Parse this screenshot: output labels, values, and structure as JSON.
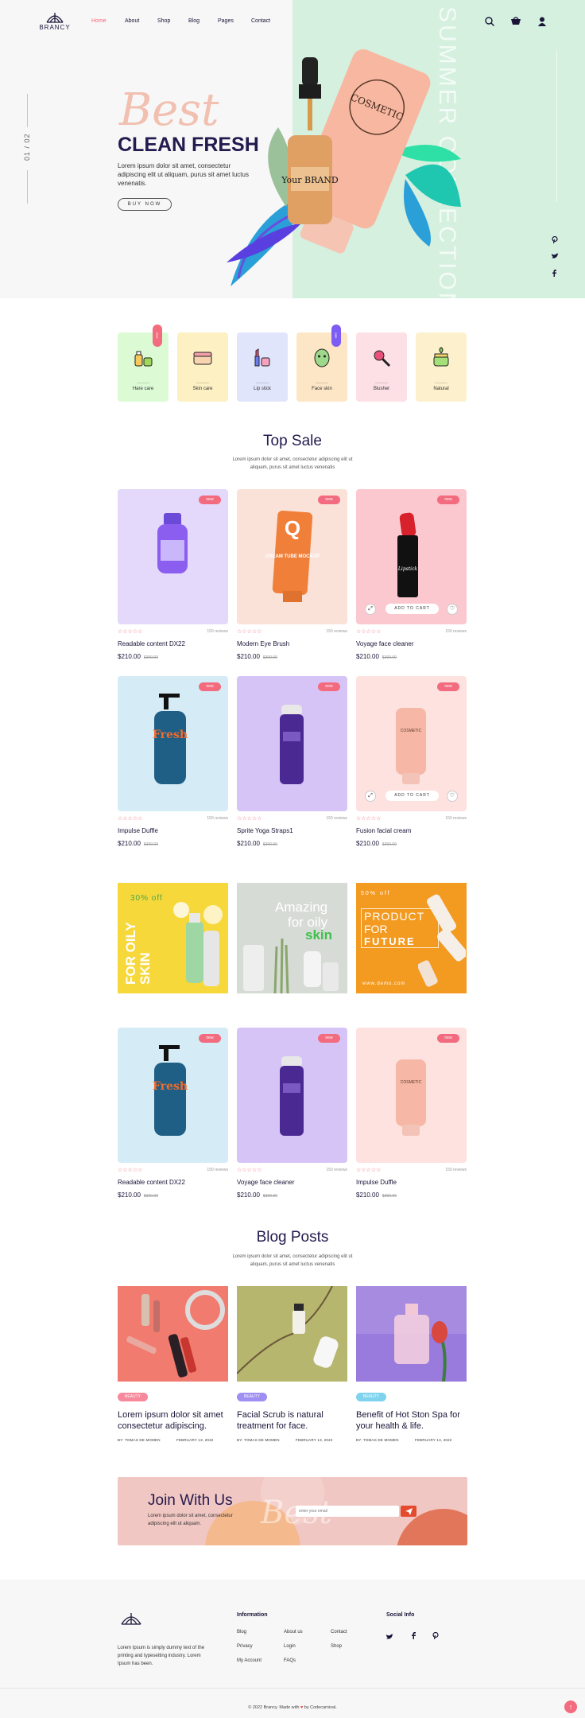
{
  "brand": {
    "name": "BRANCY"
  },
  "nav": {
    "home": "Home",
    "about": "About",
    "shop": "Shop",
    "blog": "Blog",
    "pages": "Pages",
    "contact": "Contact"
  },
  "icons": {
    "search": "search-icon",
    "cart": "cart-icon",
    "user": "user-icon",
    "pinterest": "pinterest-icon",
    "twitter": "twitter-icon",
    "facebook": "facebook-icon"
  },
  "hero": {
    "slide_counter": "01 / 02",
    "script": "Best",
    "title": "CLEAN FRESH",
    "description": "Lorem ipsum dolor sit amet, consectetur adipiscing elit ut aliquam, purus sit amet luctus venenatis.",
    "button": "BUY NOW",
    "side_text": "SUMMER COLLECTION",
    "tube_label": "COSMETIC",
    "bottle_label": "Your BRAND"
  },
  "categories": [
    {
      "label": "Hare care",
      "bg": "#dcfbd5",
      "badge": "new",
      "badge_color": "#f36b7f"
    },
    {
      "label": "Skin care",
      "bg": "#fdf0c3"
    },
    {
      "label": "Lip stick",
      "bg": "#e1e5fb"
    },
    {
      "label": "Face skin",
      "bg": "#fde6c6",
      "badge": "sale",
      "badge_color": "#7c5cf4"
    },
    {
      "label": "Blusher",
      "bg": "#fde0e6"
    },
    {
      "label": "Natural",
      "bg": "#fdf0cd"
    }
  ],
  "top_sale": {
    "title": "Top Sale",
    "description": "Lorem ipsum dolor sit amet, consectetur adipiscing elit ut aliquam, purus sit amet luctus venenatis"
  },
  "product_common": {
    "badge": "new",
    "stars": "☆☆☆☆☆",
    "add_to_cart": "ADD TO CART",
    "expand_icon": "expand-icon",
    "heart_icon": "heart-icon"
  },
  "products": [
    {
      "name": "Readable content DX22",
      "price": "$210.00",
      "old_price": "$300.00",
      "reviews": "150 reviews",
      "bg": "#e4d8fb"
    },
    {
      "name": "Modern Eye Brush",
      "price": "$210.00",
      "old_price": "$300.00",
      "reviews": "150 reviews",
      "bg": "#fbe2d8"
    },
    {
      "name": "Voyage face cleaner",
      "price": "$210.00",
      "old_price": "$300.00",
      "reviews": "150 reviews",
      "bg": "#fbc8cf"
    },
    {
      "name": "Impulse Duffle",
      "price": "$210.00",
      "old_price": "$300.00",
      "reviews": "150 reviews",
      "bg": "#d5ecf7"
    },
    {
      "name": "Sprite Yoga Straps1",
      "price": "$210.00",
      "old_price": "$300.00",
      "reviews": "150 reviews",
      "bg": "#d7c4f6"
    },
    {
      "name": "Fusion facial cream",
      "price": "$210.00",
      "old_price": "$300.00",
      "reviews": "150 reviews",
      "bg": "#fde2df"
    },
    {
      "name": "Readable content DX22",
      "price": "$210.00",
      "old_price": "$300.00",
      "reviews": "150 reviews",
      "bg": "#d5ecf7"
    },
    {
      "name": "Voyage face cleaner",
      "price": "$210.00",
      "old_price": "$300.00",
      "reviews": "150 reviews",
      "bg": "#d7c4f6"
    },
    {
      "name": "Impulse Duffle",
      "price": "$210.00",
      "old_price": "$300.00",
      "reviews": "150 reviews",
      "bg": "#fde2df"
    }
  ],
  "product_art": {
    "cream_tube": "CREAM TUBE MOCKUP",
    "tube_letter": "Q",
    "fresh": "Fresh",
    "cosmetic": "COSMETIC",
    "lipstick": "Lipstick"
  },
  "banners": {
    "b1_discount": "30% off",
    "b1_text": "FOR OILY SKIN",
    "b2_line1": "Amazing",
    "b2_line2": "for oily",
    "b2_line3": "skin",
    "b3_off": "50% off",
    "b3_line1": "PRODUCT",
    "b3_line2": "FOR",
    "b3_line3": "FUTURE",
    "b3_url": "www.demo.com"
  },
  "blog": {
    "title": "Blog Posts",
    "description": "Lorem ipsum dolor sit amet, consectetur adipiscing elit ut aliquam, purus sit amet luctus venenatis",
    "posts": [
      {
        "tag": "BEAUTY",
        "tag_color": "#f6899b",
        "title": "Lorem ipsum dolor sit amet consectetur adipiscing.",
        "author": "BY: TOMAS DE MOMEN",
        "date": "FEBRUARY 13, 2022"
      },
      {
        "tag": "BEAUTY",
        "tag_color": "#a08ff2",
        "title": "Facial Scrub is natural treatment for face.",
        "author": "BY: TOMAS DE MOMEN",
        "date": "FEBRUARY 13, 2022"
      },
      {
        "tag": "BEAUTY",
        "tag_color": "#7fd3ee",
        "title": "Benefit of Hot Ston Spa for your health & life.",
        "author": "BY: TOMAS DE MOMEN",
        "date": "FEBRUARY 13, 2022"
      }
    ]
  },
  "join": {
    "title": "Join With Us",
    "description": "Lorem ipsum dolor sit amet, consectetur adipiscing elit ut aliquam.",
    "script": "Best",
    "email_placeholder": "enter your email",
    "send_icon": "send-icon"
  },
  "footer": {
    "about": "Lorem Ipsum is simply dummy text of the printing and typesetting industry. Lorem Ipsum has been.",
    "information_heading": "Information",
    "links_col1": [
      "Blog",
      "Privacy",
      "My Account"
    ],
    "links_col2": [
      "About us",
      "Login",
      "FAQs"
    ],
    "links_col3": [
      "Contact",
      "Shop"
    ],
    "social_heading": "Social Info",
    "copyright_prefix": "© 2022 Brancy. Made with",
    "copyright_suffix": "by Codecarnival.",
    "heart": "♥",
    "to_top": "↑"
  },
  "colors": {
    "accent": "#f36b7f",
    "primary": "#231a4e",
    "hero_green": "#d5f0df",
    "hero_grey": "#f7f7f7"
  }
}
